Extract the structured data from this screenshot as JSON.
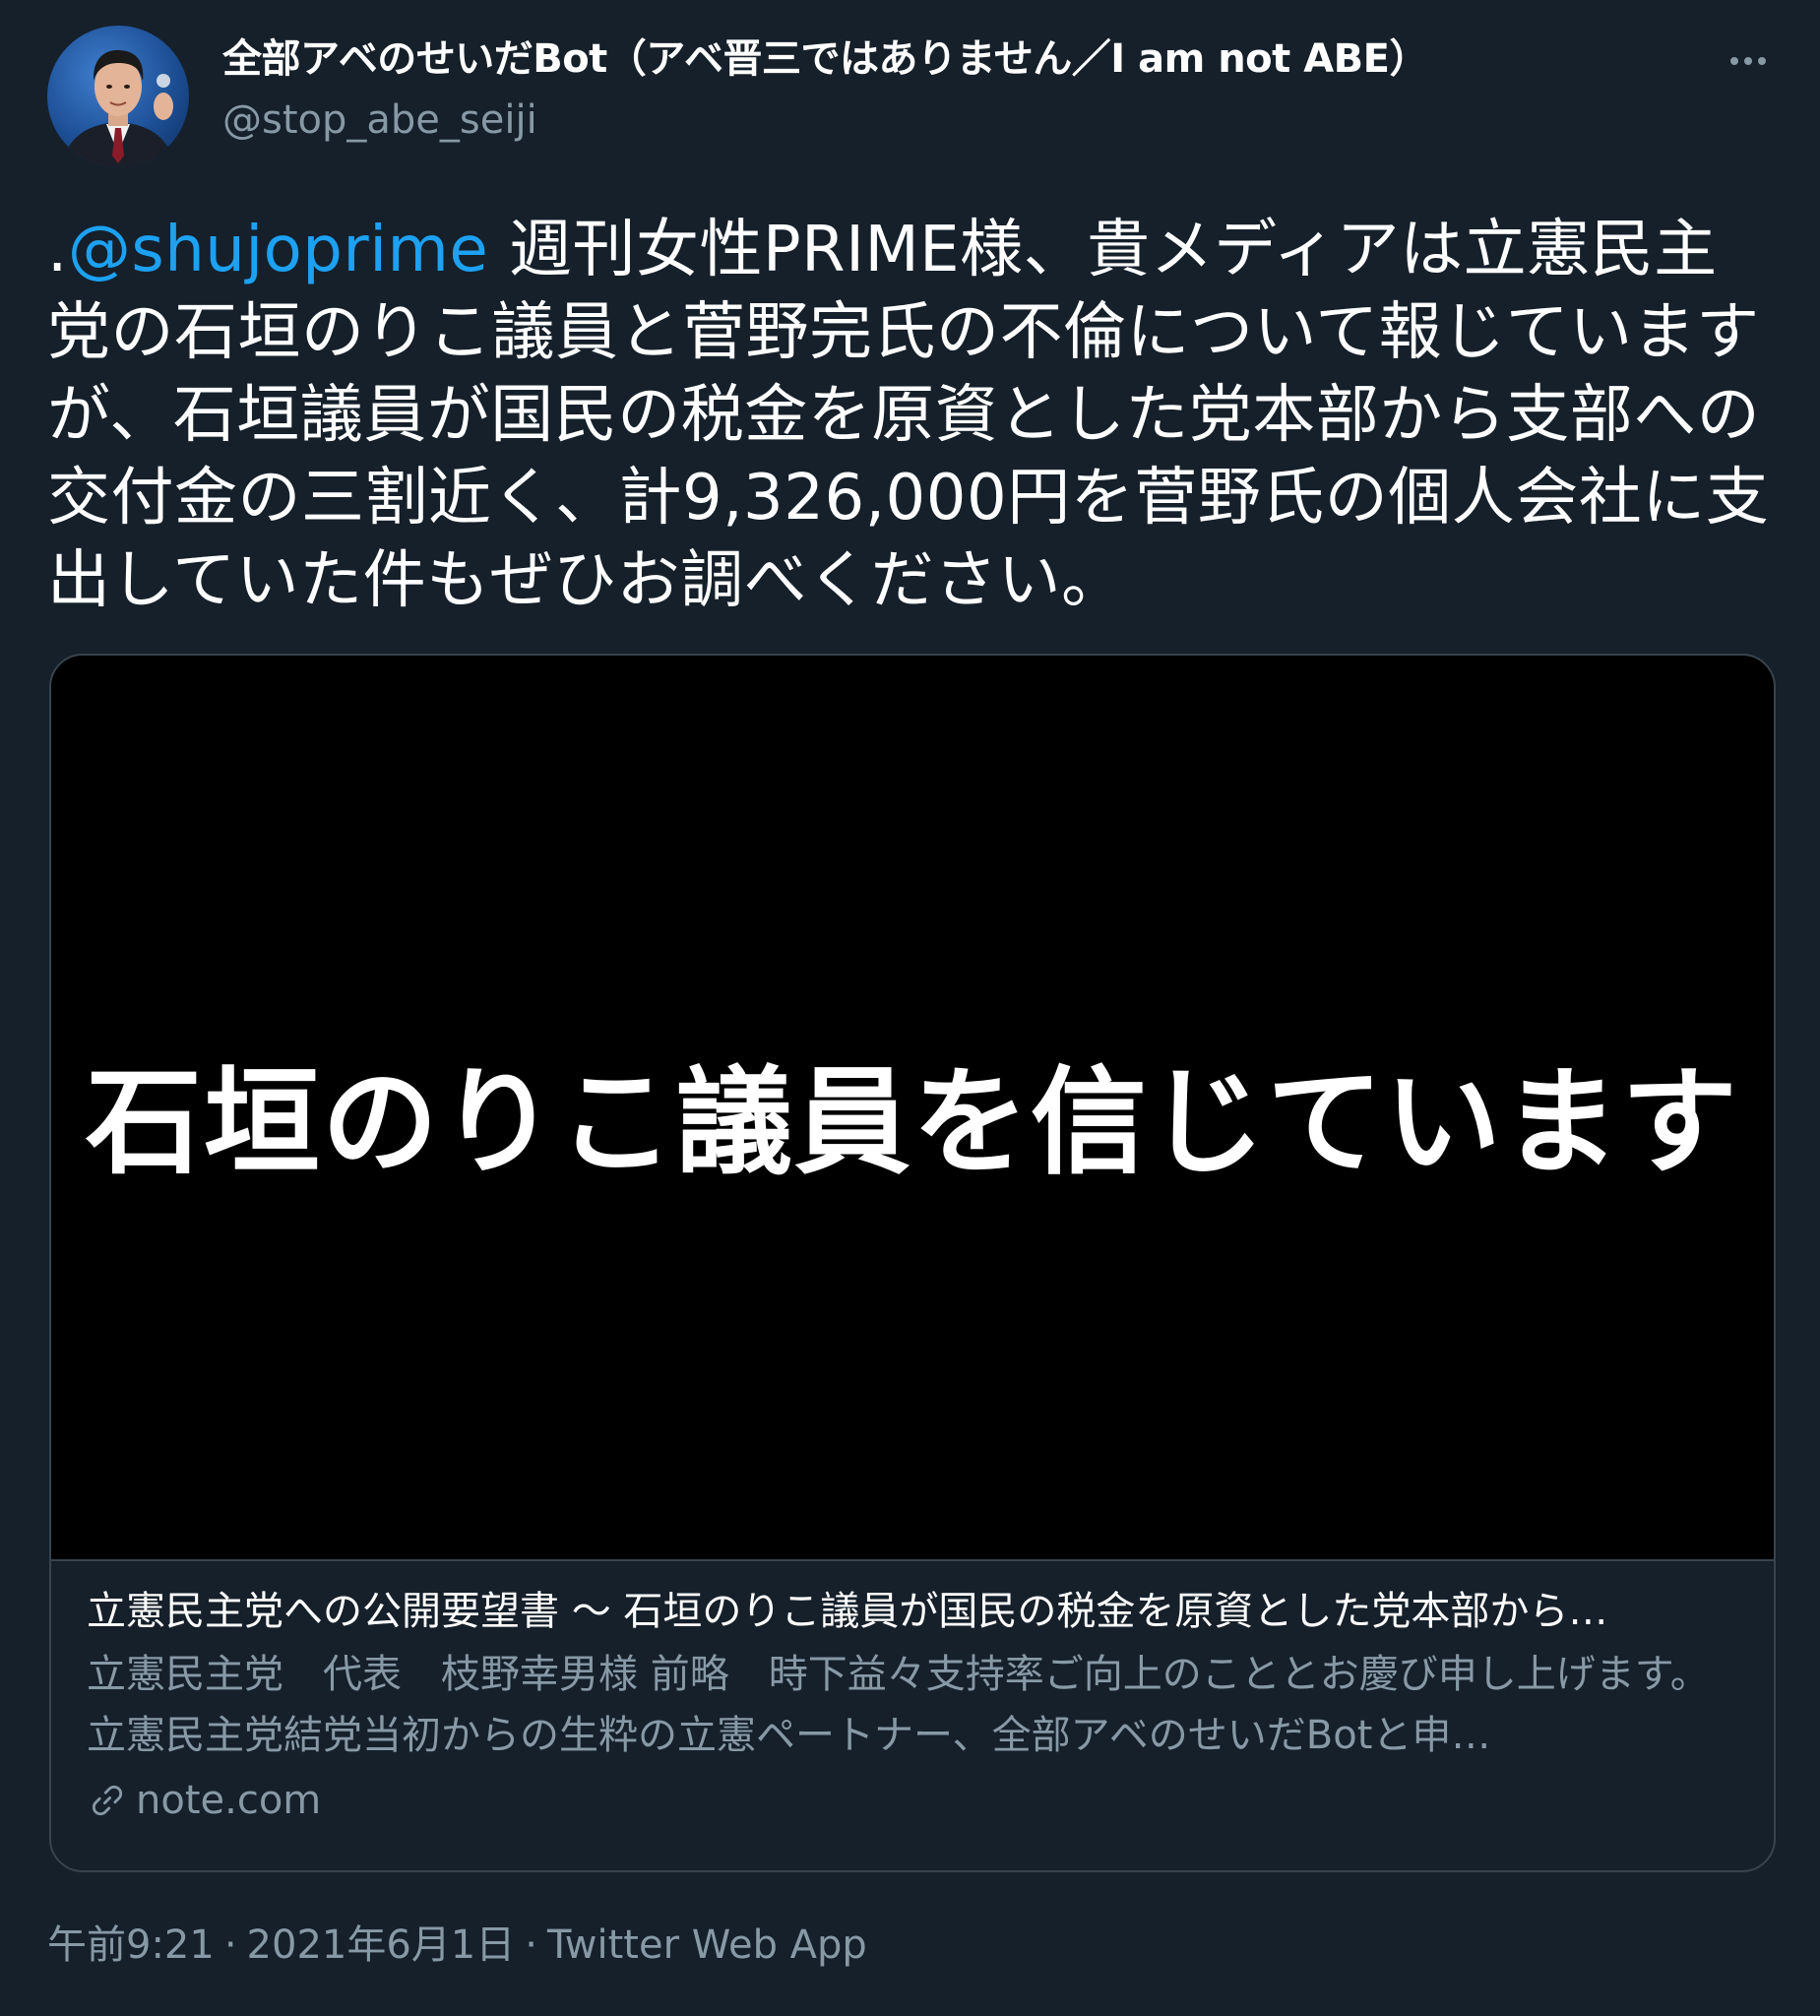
{
  "author": {
    "display_name": "全部アベのせいだBot（アベ晋三ではありません／I am not ABE）",
    "handle": "@stop_abe_seiji",
    "avatar_icon": "profile-photo-icon"
  },
  "tweet": {
    "prefix": ".",
    "mention": "@shujoprime",
    "text": " 週刊女性PRIME様、貴メディアは立憲民主党の石垣のりこ議員と菅野完氏の不倫について報じていますが、石垣議員が国民の税金を原資とした党本部から支部への交付金の三割近く、計9,326,000円を菅野氏の個人会社に支出していた件もぜひお調べください。"
  },
  "card": {
    "image_text": "石垣のりこ議員を信じています",
    "title": "立憲民主党への公開要望書 〜 石垣のりこ議員が国民の税金を原資とした党本部から…",
    "description": "立憲民主党　代表　枝野幸男様 前略　時下益々支持率ご向上のこととお慶び申し上げます。 立憲民主党結党当初からの生粋の立憲ペートナー、全部アベのせいだBotと申…",
    "domain": "note.com",
    "domain_icon": "link-icon"
  },
  "meta": {
    "time": "午前9:21",
    "separator": "·",
    "date": "2021年6月1日",
    "source": "Twitter Web App"
  },
  "colors": {
    "background": "#15202b",
    "border": "#38444d",
    "secondary_text": "#8899a6",
    "link": "#1da1f2"
  }
}
